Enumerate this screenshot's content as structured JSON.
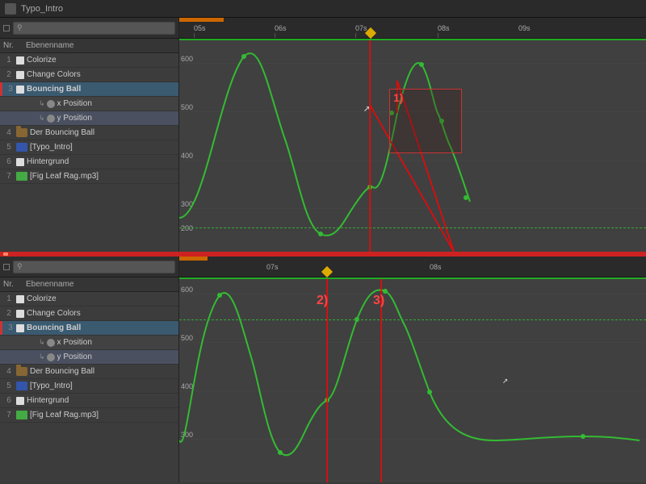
{
  "app": {
    "title": "Typo_Intro"
  },
  "panel1": {
    "search_placeholder": "",
    "col_nr": "Nr.",
    "col_name": "Ebenenname",
    "layers": [
      {
        "num": "1",
        "label": "Colorize",
        "type": "solid",
        "indent": 0
      },
      {
        "num": "2",
        "label": "Change Colors",
        "type": "solid",
        "indent": 0
      },
      {
        "num": "3",
        "label": "Bouncing Ball",
        "type": "solid",
        "indent": 0,
        "active": true
      },
      {
        "num": "",
        "label": "x Position",
        "type": "sub",
        "indent": 1
      },
      {
        "num": "",
        "label": "y Position",
        "type": "sub",
        "indent": 1
      },
      {
        "num": "4",
        "label": "Der Bouncing Ball",
        "type": "folder",
        "indent": 0
      },
      {
        "num": "5",
        "label": "[Typo_Intro]",
        "type": "comp",
        "indent": 0
      },
      {
        "num": "6",
        "label": "Hintergrund",
        "type": "solid",
        "indent": 0
      },
      {
        "num": "7",
        "label": "[Fig Leaf Rag.mp3]",
        "type": "audio",
        "indent": 0
      }
    ],
    "ruler": {
      "marks": [
        "05s",
        "06s",
        "07s",
        "08s",
        "09s"
      ],
      "cursor_pos": "07s"
    },
    "annotation": "1)"
  },
  "panel2": {
    "layers": [
      {
        "num": "1",
        "label": "Colorize",
        "type": "solid",
        "indent": 0
      },
      {
        "num": "2",
        "label": "Change Colors",
        "type": "solid",
        "indent": 0
      },
      {
        "num": "3",
        "label": "Bouncing Ball",
        "type": "solid",
        "indent": 0,
        "active": true
      },
      {
        "num": "",
        "label": "x Position",
        "type": "sub",
        "indent": 1
      },
      {
        "num": "",
        "label": "y Position",
        "type": "sub",
        "indent": 1
      },
      {
        "num": "4",
        "label": "Der Bouncing Ball",
        "type": "folder",
        "indent": 0
      },
      {
        "num": "5",
        "label": "[Typo_Intro]",
        "type": "comp",
        "indent": 0
      },
      {
        "num": "6",
        "label": "Hintergrund",
        "type": "solid",
        "indent": 0
      },
      {
        "num": "7",
        "label": "[Fig Leaf Rag.mp3]",
        "type": "audio",
        "indent": 0
      }
    ],
    "ruler": {
      "marks": [
        "07s",
        "08s"
      ],
      "cursor_pos": "07s"
    },
    "annotations": [
      "2)",
      "3)"
    ]
  },
  "y_axis": {
    "values_top": [
      "600",
      "500",
      "400",
      "300",
      "200"
    ],
    "values_bottom": [
      "600",
      "500",
      "400",
      "300"
    ]
  },
  "colors": {
    "accent_red": "#cc2222",
    "accent_green": "#33bb33",
    "accent_orange": "#cc6600",
    "accent_yellow": "#ddaa00",
    "sidebar_bg": "#3c3c3c",
    "timeline_bg": "#404040",
    "active_row": "#4e6070"
  }
}
